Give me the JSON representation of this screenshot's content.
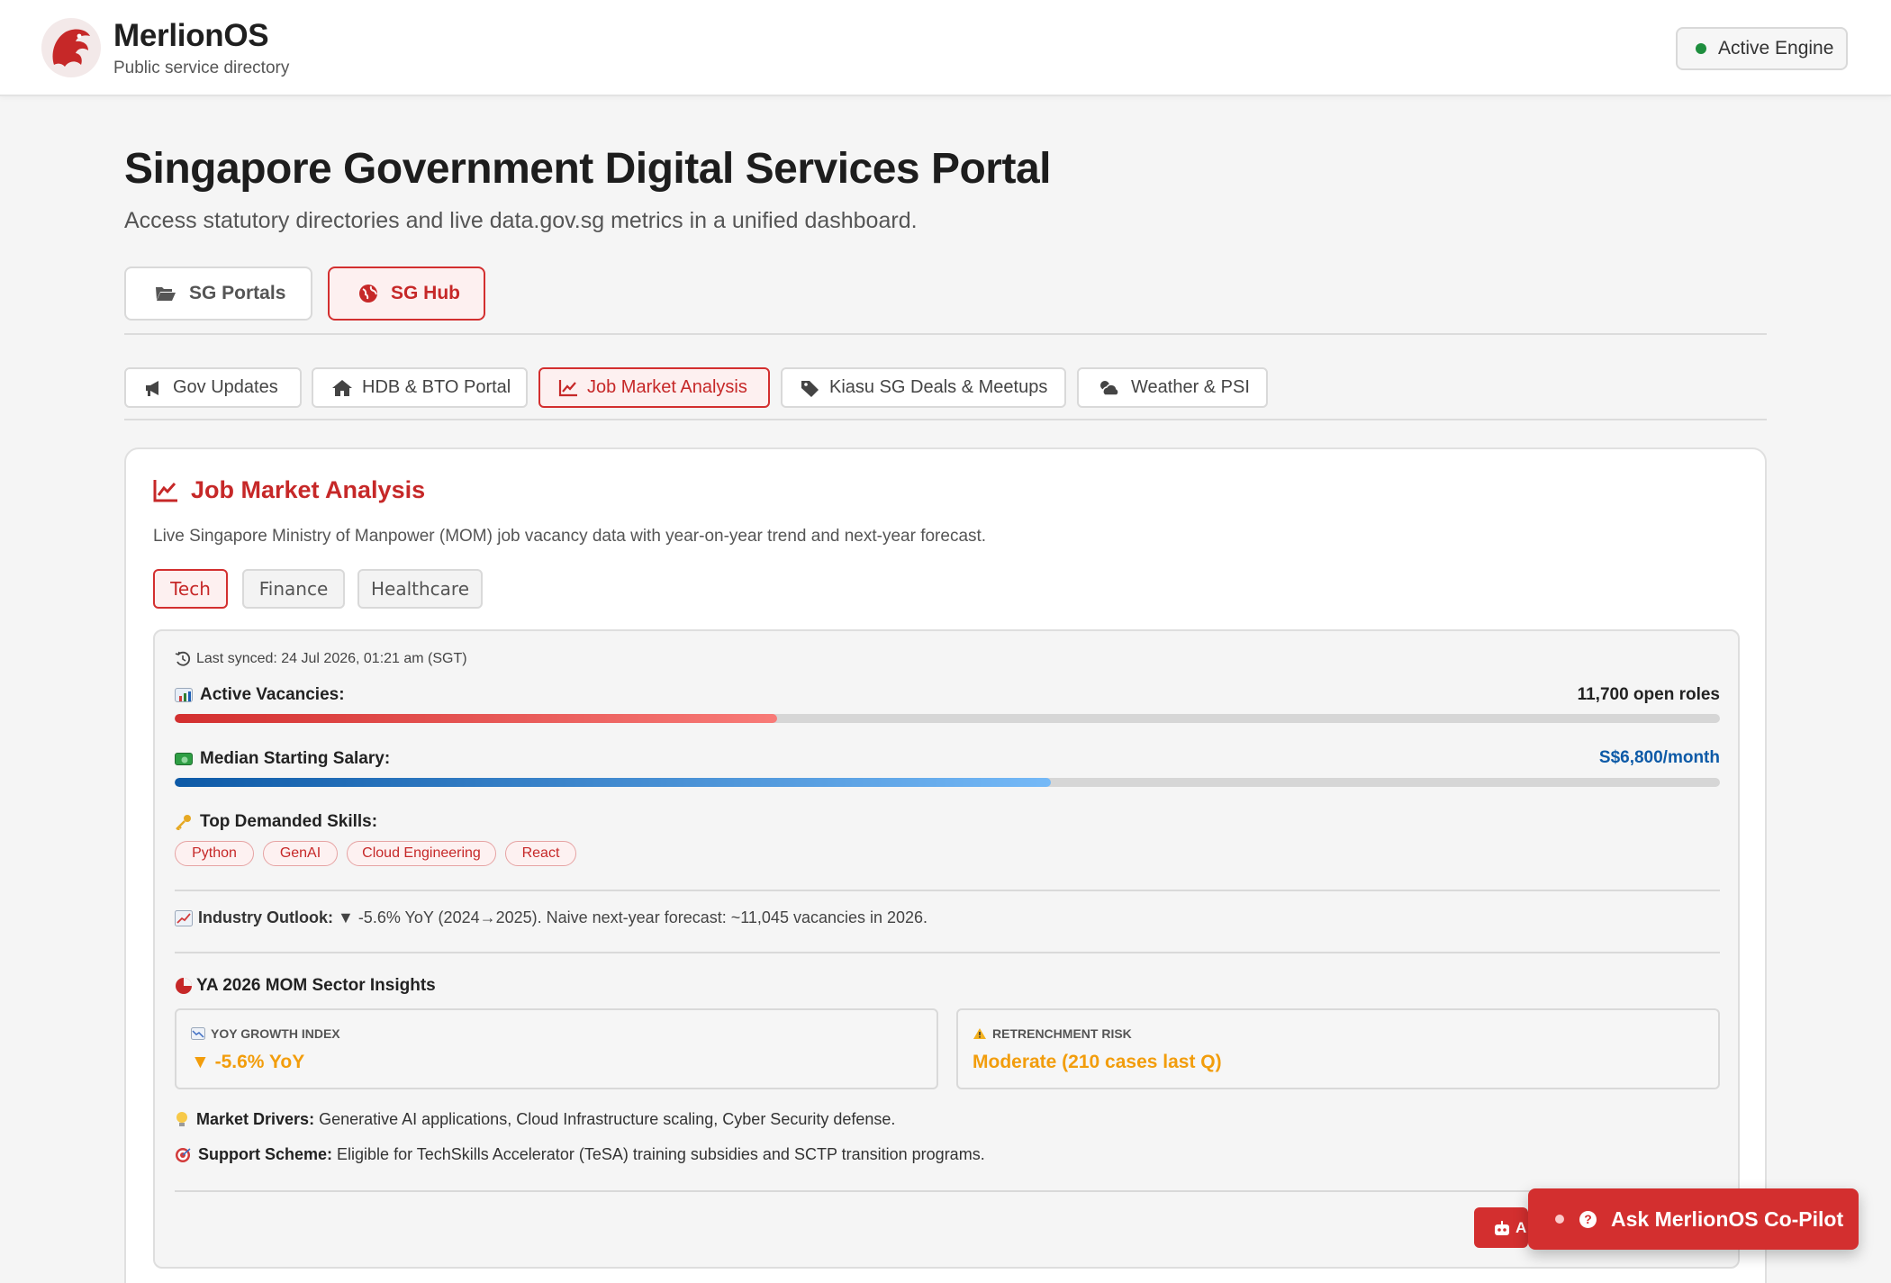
{
  "header": {
    "brand_name": "MerlionOS",
    "brand_sub": "Public service directory",
    "engine_status": "Active Engine"
  },
  "page": {
    "title": "Singapore Government Digital Services Portal",
    "subtitle": "Access statutory directories and live data.gov.sg metrics in a unified dashboard."
  },
  "top_tabs": [
    {
      "label": "SG Portals",
      "icon": "folder-open-icon"
    },
    {
      "label": "SG Hub",
      "icon": "globe-icon",
      "active": true
    }
  ],
  "sub_tabs": [
    {
      "label": "Gov Updates",
      "icon": "megaphone-icon"
    },
    {
      "label": "HDB & BTO Portal",
      "icon": "home-icon"
    },
    {
      "label": "Job Market Analysis",
      "icon": "chart-line-icon",
      "active": true
    },
    {
      "label": "Kiasu SG Deals & Meetups",
      "icon": "tag-icon"
    },
    {
      "label": "Weather & PSI",
      "icon": "cloud-sun-icon"
    }
  ],
  "card": {
    "title": "Job Market Analysis",
    "description": "Live Singapore Ministry of Manpower (MOM) job vacancy data with year-on-year trend and next-year forecast.",
    "sectors": [
      "Tech",
      "Finance",
      "Healthcare"
    ],
    "active_sector": "Tech",
    "last_synced": "Last synced: 24 Jul 2026, 01:21 am (SGT)",
    "vacancies": {
      "label": "Active Vacancies:",
      "value": "11,700 open roles",
      "fill_fraction": 0.39
    },
    "salary": {
      "label": "Median Starting Salary:",
      "value": "S$6,800/month",
      "fill_fraction": 0.567
    },
    "skills": {
      "label": "Top Demanded Skills:",
      "items": [
        "Python",
        "GenAI",
        "Cloud Engineering",
        "React"
      ]
    },
    "outlook": {
      "label": "Industry Outlook:",
      "text": "▼ -5.6% YoY (2024→2025). Naive next-year forecast: ~11,045 vacancies in 2026."
    },
    "insights": {
      "title": "YA 2026 MOM Sector Insights",
      "growth_label": "YOY GROWTH INDEX",
      "growth_value": "▼ -5.6% YoY",
      "risk_label": "RETRENCHMENT RISK",
      "risk_value": "Moderate (210 cases last Q)"
    },
    "drivers": {
      "label": "Market Drivers:",
      "text": "Generative AI applications, Cloud Infrastructure scaling, Cyber Security defense."
    },
    "support": {
      "label": "Support Scheme:",
      "text": "Eligible for TechSkills Accelerator (TeSA) training subsidies and SCTP transition programs."
    }
  },
  "mini_button_label": "A",
  "copilot_label": "Ask MerlionOS Co-Pilot",
  "colors": {
    "accent": "#d32f2f",
    "salary_blue": "#0d5aa7",
    "warning_orange": "#f29d0c",
    "status_green": "#1e8e3e"
  }
}
